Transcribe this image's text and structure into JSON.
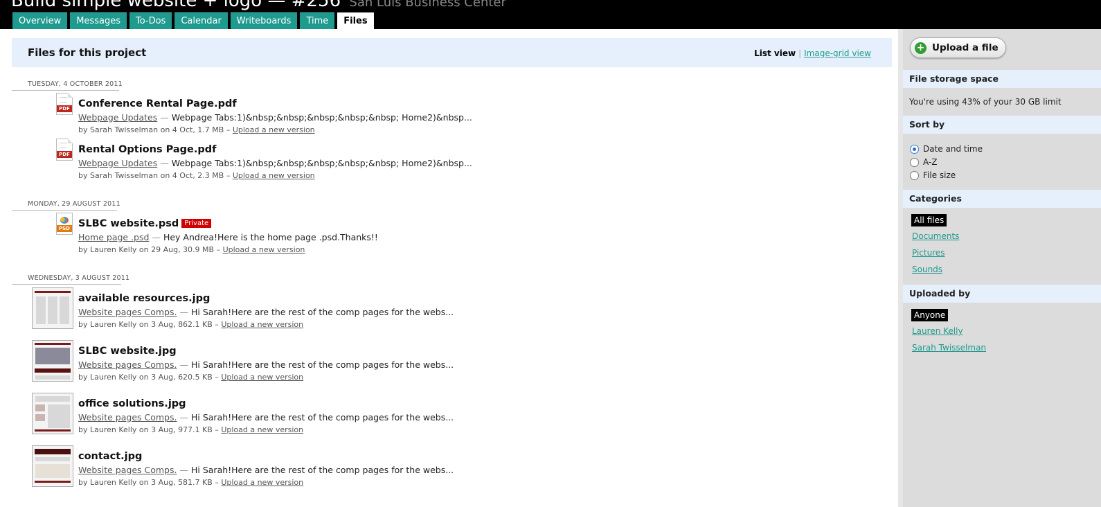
{
  "header": {
    "project_title": "Build simple website + logo — #256",
    "client": "San Luis Business Center"
  },
  "tabs": [
    {
      "label": "Overview"
    },
    {
      "label": "Messages"
    },
    {
      "label": "To-Dos"
    },
    {
      "label": "Calendar"
    },
    {
      "label": "Writeboards"
    },
    {
      "label": "Time"
    },
    {
      "label": "Files"
    }
  ],
  "main": {
    "title": "Files for this project",
    "view_current": "List view",
    "view_separator": "|",
    "view_other": "Image-grid view"
  },
  "groups": [
    {
      "date": "TUESDAY, 4 OCTOBER 2011",
      "files": [
        {
          "name": "Conference Rental Page.pdf",
          "icon": "pdf-icon",
          "icon_label": "PDF",
          "category": "Webpage Updates",
          "dash": "—",
          "excerpt": "Webpage Tabs:1)&nbsp;&nbsp;&nbsp;&nbsp;&nbsp; Home2)&nbsp...",
          "meta": "by Sarah Twisselman on 4 Oct, 1.7 MB –",
          "upload": "Upload a new version"
        },
        {
          "name": "Rental Options Page.pdf",
          "icon": "pdf-icon",
          "icon_label": "PDF",
          "category": "Webpage Updates",
          "dash": "—",
          "excerpt": "Webpage Tabs:1)&nbsp;&nbsp;&nbsp;&nbsp;&nbsp; Home2)&nbsp...",
          "meta": "by Sarah Twisselman on 4 Oct, 2.3 MB –",
          "upload": "Upload a new version"
        }
      ]
    },
    {
      "date": "MONDAY, 29 AUGUST 2011",
      "files": [
        {
          "name": "SLBC website.psd",
          "private": "Private",
          "icon": "psd-icon",
          "icon_label": "PSD",
          "category": "Home page .psd",
          "dash": "—",
          "excerpt": "Hey Andrea!Here is the home page .psd.Thanks!!",
          "meta": "by Lauren Kelly on 29 Aug, 30.9 MB –",
          "upload": "Upload a new version"
        }
      ]
    },
    {
      "date": "WEDNESDAY, 3 AUGUST 2011",
      "files": [
        {
          "name": "available resources.jpg",
          "icon": "image-thumbnail",
          "category": "Website pages Comps.",
          "dash": "—",
          "excerpt": "Hi Sarah!Here are the rest of the comp pages for the webs...",
          "meta": "by Lauren Kelly on 3 Aug, 862.1 KB –",
          "upload": "Upload a new version"
        },
        {
          "name": "SLBC website.jpg",
          "icon": "image-thumbnail",
          "category": "Website pages Comps.",
          "dash": "—",
          "excerpt": "Hi Sarah!Here are the rest of the comp pages for the webs...",
          "meta": "by Lauren Kelly on 3 Aug, 620.5 KB –",
          "upload": "Upload a new version"
        },
        {
          "name": "office solutions.jpg",
          "icon": "image-thumbnail",
          "category": "Website pages Comps.",
          "dash": "—",
          "excerpt": "Hi Sarah!Here are the rest of the comp pages for the webs...",
          "meta": "by Lauren Kelly on 3 Aug, 977.1 KB –",
          "upload": "Upload a new version"
        },
        {
          "name": "contact.jpg",
          "icon": "image-thumbnail",
          "category": "Website pages Comps.",
          "dash": "—",
          "excerpt": "Hi Sarah!Here are the rest of the comp pages for the webs...",
          "meta": "by Lauren Kelly on 3 Aug, 581.7 KB –",
          "upload": "Upload a new version"
        }
      ]
    }
  ],
  "sidebar": {
    "upload_button": "Upload a file",
    "storage_title": "File storage space",
    "storage_text": "You're using 43% of your 30 GB limit",
    "sort_title": "Sort by",
    "sort_options": [
      {
        "label": "Date and time",
        "selected": true
      },
      {
        "label": "A-Z",
        "selected": false
      },
      {
        "label": "File size",
        "selected": false
      }
    ],
    "categories_title": "Categories",
    "categories": [
      {
        "label": "All files",
        "selected": true
      },
      {
        "label": "Documents",
        "selected": false
      },
      {
        "label": "Pictures",
        "selected": false
      },
      {
        "label": "Sounds",
        "selected": false
      }
    ],
    "uploaded_title": "Uploaded by",
    "uploaders": [
      {
        "label": "Anyone",
        "selected": true
      },
      {
        "label": "Lauren Kelly",
        "selected": false
      },
      {
        "label": "Sarah Twisselman",
        "selected": false
      }
    ]
  },
  "colors": {
    "tab_bg": "#1f9a8e",
    "header_bg": "#000000",
    "panel_header_bg": "#e6f0fc",
    "sidebar_bg": "#dcdcdc",
    "private_badge": "#d10000",
    "link": "#1f9a8e"
  }
}
